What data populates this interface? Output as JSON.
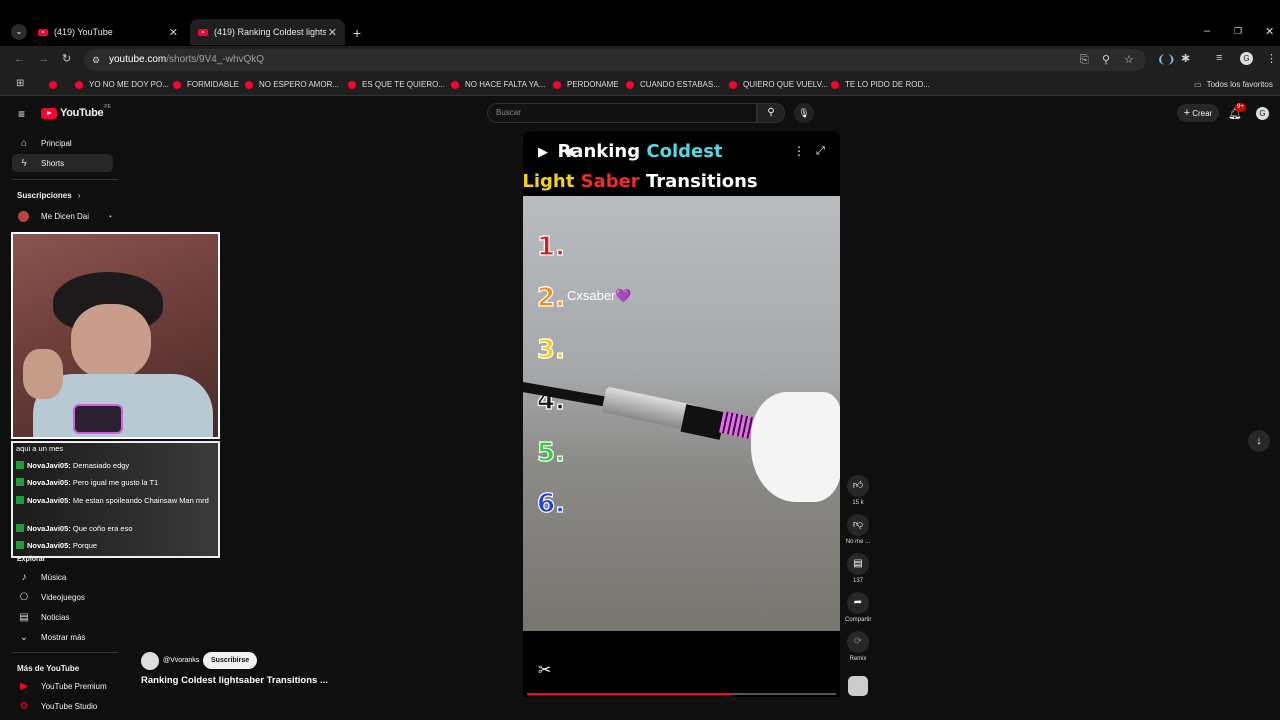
{
  "browser": {
    "tabs": [
      {
        "title": "(419) YouTube"
      },
      {
        "title": "(419) Ranking Coldest lightsab"
      }
    ],
    "url_host": "youtube.com",
    "url_path": "/shorts/9V4_-whvQkQ",
    "bookmarks": [
      "YO NO ME DOY PO...",
      "FORMIDABLE",
      "NO ESPERO AMOR...",
      "ES QUE TE QUIERO...",
      "NO HACE FALTA YA...",
      "PERDONAME",
      "CUANDO ESTABAS...",
      "QUIERO QUE VUELV...",
      "TE LO PIDO DE ROD..."
    ],
    "all_bookmarks": "Todos los favoritos"
  },
  "header": {
    "logo": "YouTube",
    "region": "PE",
    "search_placeholder": "Buscar",
    "create_label": "Crear",
    "notifications": "9+"
  },
  "sidebar": {
    "items": [
      {
        "label": "Principal"
      },
      {
        "label": "Shorts"
      }
    ],
    "subscriptions_title": "Suscripciones",
    "subscription": "Me Dicen Dai",
    "explore_title": "Explorar",
    "explore_items": [
      {
        "label": "Música"
      },
      {
        "label": "Videojuegos"
      },
      {
        "label": "Noticias"
      },
      {
        "label": "Mostrar más"
      }
    ],
    "more_title": "Más de YouTube",
    "more_items": [
      {
        "label": "YouTube Premium"
      },
      {
        "label": "YouTube Studio"
      }
    ]
  },
  "chat": {
    "top_line": "aqui a un mes",
    "messages": [
      {
        "user": "NovaJavi05:",
        "text": "Demasiado edgy"
      },
      {
        "user": "NovaJavi05:",
        "text": "Pero igual me gusto la T1"
      },
      {
        "user": "NovaJavi05:",
        "text": "Me estan spoileando Chainsaw Man mrd"
      },
      {
        "user": "NovaJavi05:",
        "text": "Que coño era eso"
      },
      {
        "user": "NovaJavi05:",
        "text": "Porque"
      }
    ]
  },
  "short": {
    "title_line1_a": "Ranking ",
    "title_line1_b": "Coldest",
    "title_line2_a": "Light ",
    "title_line2_b": "Saber ",
    "title_line2_c": "Transitions",
    "ranks": [
      "1.",
      "2.",
      "3.",
      "4.",
      "5.",
      "6."
    ],
    "rank_colors": [
      "#e01b1b",
      "#f0901e",
      "#f2d31a",
      "#1a1a1a",
      "#2fd03a",
      "#1f3fe0"
    ],
    "rank2_label": "Cxsaber💜",
    "channel": "@Vvoranks",
    "subscribe_label": "Suscribirse",
    "video_title": "Ranking Coldest lightsaber Transitions ...",
    "progress": 0.66
  },
  "actions": {
    "like_count": "15 k",
    "dislike_label": "No me ...",
    "comments_count": "137",
    "share_label": "Compartir",
    "remix_label": "Remix"
  }
}
